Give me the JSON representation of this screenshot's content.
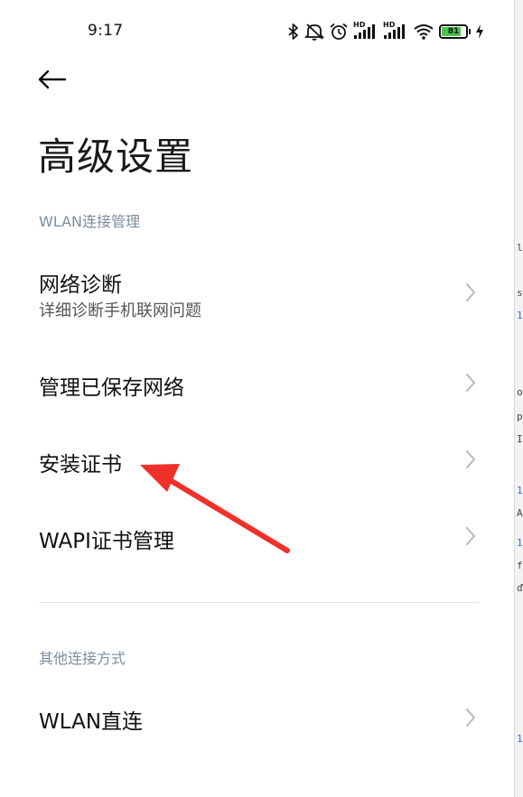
{
  "status_bar": {
    "time": "9:17",
    "battery_level": "81",
    "battery_percent": 81,
    "icons": [
      "bluetooth-icon",
      "mute-icon",
      "alarm-icon",
      "hd-signal-icon",
      "hd-signal-icon",
      "wifi-icon",
      "battery-icon",
      "charging-icon"
    ],
    "hd_labels": [
      "HD",
      "HD"
    ]
  },
  "header": {
    "back_icon": "back-arrow-icon",
    "title": "高级设置"
  },
  "sections": [
    {
      "title": "WLAN连接管理",
      "items": [
        {
          "label": "网络诊断",
          "subtitle": "详细诊断手机联网问题",
          "icon": "chevron-right-icon"
        },
        {
          "label": "管理已保存网络",
          "icon": "chevron-right-icon"
        },
        {
          "label": "安装证书",
          "icon": "chevron-right-icon"
        },
        {
          "label": "WAPI证书管理",
          "icon": "chevron-right-icon"
        }
      ]
    },
    {
      "title": "其他连接方式",
      "items": [
        {
          "label": "WLAN直连",
          "icon": "chevron-right-icon"
        }
      ]
    }
  ],
  "annotation": {
    "icon": "red-arrow-icon",
    "color": "#f0302a"
  },
  "colors": {
    "background": "#ffffff",
    "section_title": "#7d8c9e",
    "text": "#111111",
    "chevron": "#b8b8b8",
    "battery_fill": "#4cc34a"
  },
  "side_fragments": [
    "l",
    "½",
    "s",
    "1",
    "o",
    "p",
    "Il",
    "1",
    "A",
    "1",
    "f",
    "ď",
    "1"
  ]
}
